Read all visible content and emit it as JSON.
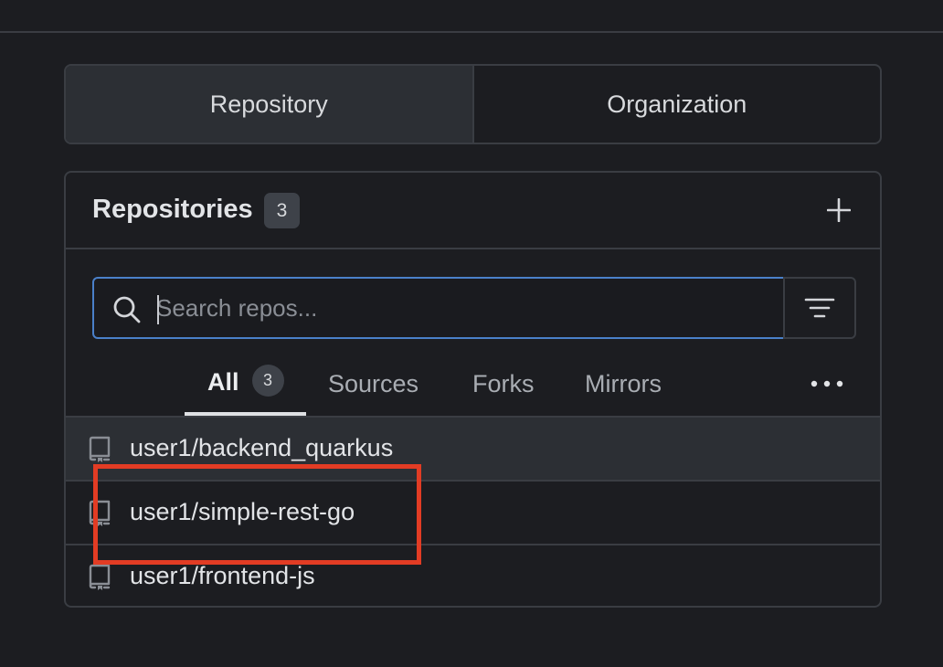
{
  "switch": {
    "items": [
      {
        "label": "Repository",
        "active": true
      },
      {
        "label": "Organization",
        "active": false
      }
    ]
  },
  "panel": {
    "title": "Repositories",
    "count": "3",
    "add_icon": "plus-icon"
  },
  "search": {
    "placeholder": "Search repos...",
    "value": "",
    "search_icon": "search-icon",
    "filter_icon": "filter-icon"
  },
  "tabs": {
    "items": [
      {
        "label": "All",
        "count": "3",
        "active": true
      },
      {
        "label": "Sources",
        "active": false
      },
      {
        "label": "Forks",
        "active": false
      },
      {
        "label": "Mirrors",
        "active": false
      }
    ],
    "more_icon": "kebab-horizontal-icon"
  },
  "repos": [
    {
      "name": "user1/backend_quarkus",
      "icon": "repo-icon"
    },
    {
      "name": "user1/simple-rest-go",
      "icon": "repo-icon"
    },
    {
      "name": "user1/frontend-js",
      "icon": "repo-icon"
    }
  ],
  "colors": {
    "background": "#1c1d21",
    "border": "#3a3d43",
    "focus_border": "#4a80c9",
    "highlight": "#e23c24"
  }
}
